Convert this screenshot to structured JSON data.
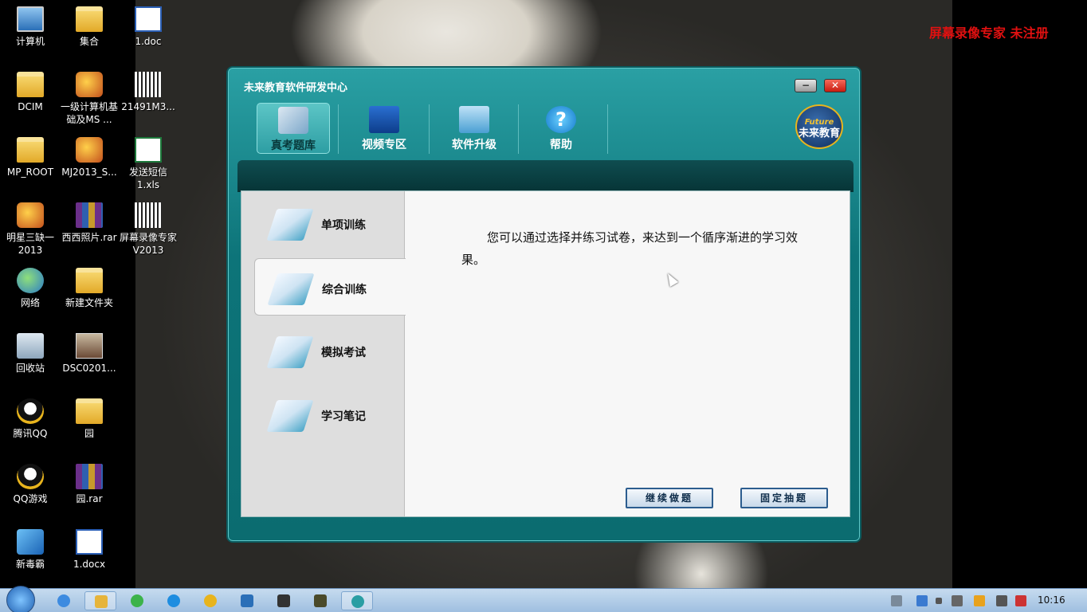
{
  "desktop": {
    "watermark": "屏幕录像专家 未注册",
    "icons": [
      {
        "label": "计算机",
        "icon": "computer-icon"
      },
      {
        "label": "集合",
        "icon": "folder-icon"
      },
      {
        "label": "1.doc",
        "icon": "word-doc-icon"
      },
      {
        "label": "DCIM",
        "icon": "folder-icon"
      },
      {
        "label": "一级计算机基础及MS ...",
        "icon": "app-icon"
      },
      {
        "label": "21491M3...",
        "icon": "audio-file-icon"
      },
      {
        "label": "MP_ROOT",
        "icon": "folder-icon"
      },
      {
        "label": "MJ2013_S...",
        "icon": "mahjong-app-icon"
      },
      {
        "label": "发送短信1.xls",
        "icon": "excel-icon"
      },
      {
        "label": "明星三缺一2013",
        "icon": "game-app-icon"
      },
      {
        "label": "西西照片.rar",
        "icon": "rar-archive-icon"
      },
      {
        "label": "屏幕录像专家V2013",
        "icon": "recorder-app-icon"
      },
      {
        "label": "网络",
        "icon": "network-icon"
      },
      {
        "label": "新建文件夹",
        "icon": "folder-icon"
      },
      {
        "label": "回收站",
        "icon": "recycle-bin-icon"
      },
      {
        "label": "DSC0201...",
        "icon": "photo-icon"
      },
      {
        "label": "腾讯QQ",
        "icon": "qq-icon"
      },
      {
        "label": "园",
        "icon": "folder-icon"
      },
      {
        "label": "QQ游戏",
        "icon": "qq-game-icon"
      },
      {
        "label": "园.rar",
        "icon": "rar-archive-icon"
      },
      {
        "label": "新毒霸",
        "icon": "antivirus-icon"
      },
      {
        "label": "1.docx",
        "icon": "word-doc-icon"
      }
    ]
  },
  "app": {
    "title": "未来教育软件研发中心",
    "minimize_symbol": "−",
    "close_symbol": "✕",
    "toolbar": [
      {
        "label": "真考题库",
        "icon": "exam-bank-icon",
        "active": true
      },
      {
        "label": "视频专区",
        "icon": "video-clapper-icon",
        "active": false
      },
      {
        "label": "软件升级",
        "icon": "upgrade-folder-gear-icon",
        "active": false
      },
      {
        "label": "帮助",
        "icon": "help-question-icon",
        "active": false
      }
    ],
    "help_glyph": "?",
    "logo": {
      "en": "Future",
      "cn": "未来教育"
    },
    "sidebar": [
      {
        "label": "单项训练",
        "active": false
      },
      {
        "label": "综合训练",
        "active": true
      },
      {
        "label": "模拟考试",
        "active": false
      },
      {
        "label": "学习笔记",
        "active": false
      }
    ],
    "description": "您可以通过选择并练习试卷，来达到一个循序渐进的学习效果。",
    "buttons": {
      "continue": "继续做题",
      "fixed_draw": "固定抽题"
    }
  },
  "taskbar": {
    "clock": "10:16",
    "items": [
      "ie-icon",
      "explorer-icon",
      "ie-green-icon",
      "ie-blue-icon",
      "qq-icon",
      "app-blue-icon",
      "clapper-icon",
      "game-icon",
      "future-edu-icon"
    ]
  }
}
